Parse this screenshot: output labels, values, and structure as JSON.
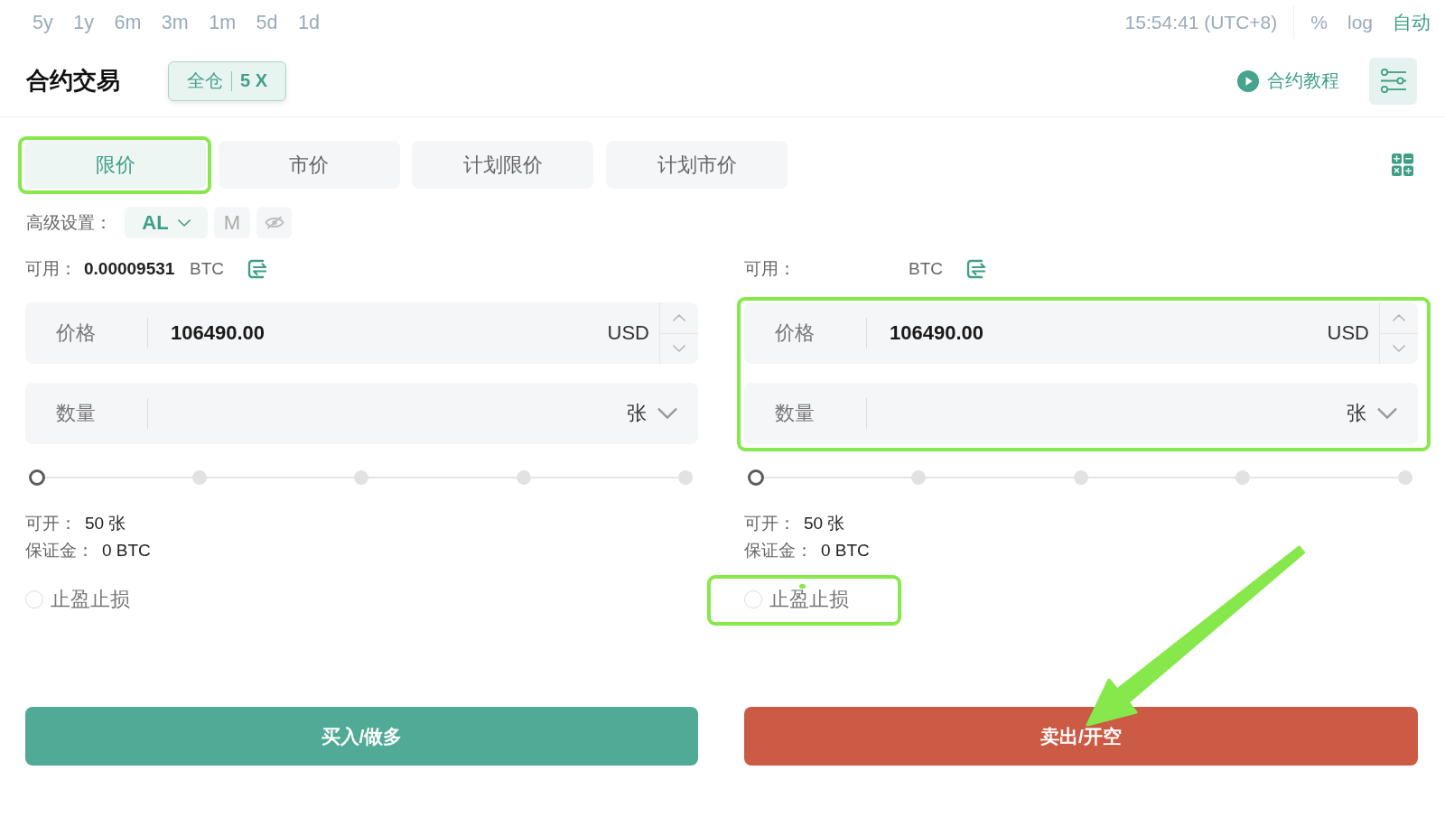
{
  "toolbar": {
    "timeframes": [
      {
        "label": "5y",
        "selected": false
      },
      {
        "label": "1y",
        "selected": false
      },
      {
        "label": "6m",
        "selected": false
      },
      {
        "label": "3m",
        "selected": false
      },
      {
        "label": "1m",
        "selected": false
      },
      {
        "label": "5d",
        "selected": false
      },
      {
        "label": "1d",
        "selected": false
      }
    ],
    "clock": "15:54:41 (UTC+8)",
    "scale_options": [
      {
        "label": "%",
        "selected": false
      },
      {
        "label": "log",
        "selected": false
      },
      {
        "label": "自动",
        "selected": true
      }
    ]
  },
  "header": {
    "title": "合约交易",
    "margin_mode": "全仓",
    "leverage": "5 X",
    "tutorial_link": "合约教程"
  },
  "order_tabs": [
    {
      "label": "限价",
      "selected": true
    },
    {
      "label": "市价",
      "selected": false
    },
    {
      "label": "计划限价",
      "selected": false
    },
    {
      "label": "计划市价",
      "selected": false
    }
  ],
  "advanced_settings": {
    "label": "高级设置：",
    "mode_selector": "AL",
    "mode_button": "M"
  },
  "columns": [
    {
      "available": {
        "label": "可用：",
        "value": "0.00009531",
        "unit": "BTC"
      },
      "price": {
        "label": "价格",
        "value": "106490.00",
        "unit": "USD"
      },
      "quantity": {
        "label": "数量",
        "unit": "张"
      },
      "slider": {
        "level": 0
      },
      "max_open": {
        "label": "可开：",
        "value": "50 张"
      },
      "margin": {
        "label": "保证金：",
        "value": "0 BTC"
      },
      "tp_sl": {
        "label": "止盈止损",
        "checked": false
      },
      "action": {
        "kind": "buy",
        "label": "买入/做多"
      }
    },
    {
      "available": {
        "label": "可用：",
        "unit": "BTC"
      },
      "price": {
        "label": "价格",
        "value": "106490.00",
        "unit": "USD"
      },
      "quantity": {
        "label": "数量",
        "unit": "张"
      },
      "slider": {
        "level": 0
      },
      "max_open": {
        "label": "可开：",
        "value": "50 张"
      },
      "margin": {
        "label": "保证金：",
        "value": "0 BTC"
      },
      "tp_sl": {
        "label": "止盈止损",
        "checked": false
      },
      "action": {
        "kind": "sell",
        "label": "卖出/开空"
      }
    }
  ]
}
